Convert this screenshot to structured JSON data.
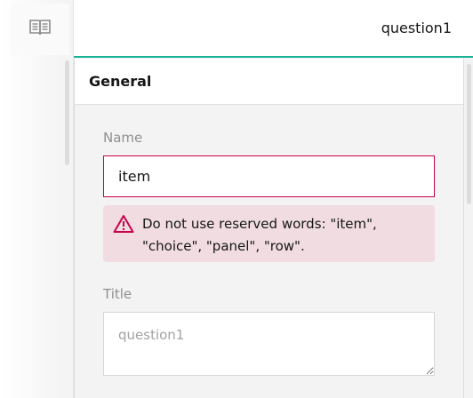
{
  "toolbar": {
    "book_icon": "book-open-icon"
  },
  "header": {
    "title": "question1",
    "accent_color": "#19b394"
  },
  "panel": {
    "section_title": "General",
    "fields": {
      "name": {
        "label": "Name",
        "value": "item"
      },
      "title": {
        "label": "Title",
        "placeholder": "question1"
      }
    },
    "error": {
      "icon": "warning-icon",
      "message": "Do not use reserved words: \"item\", \"choice\", \"panel\", \"row\".",
      "color": "#c8004b"
    }
  }
}
